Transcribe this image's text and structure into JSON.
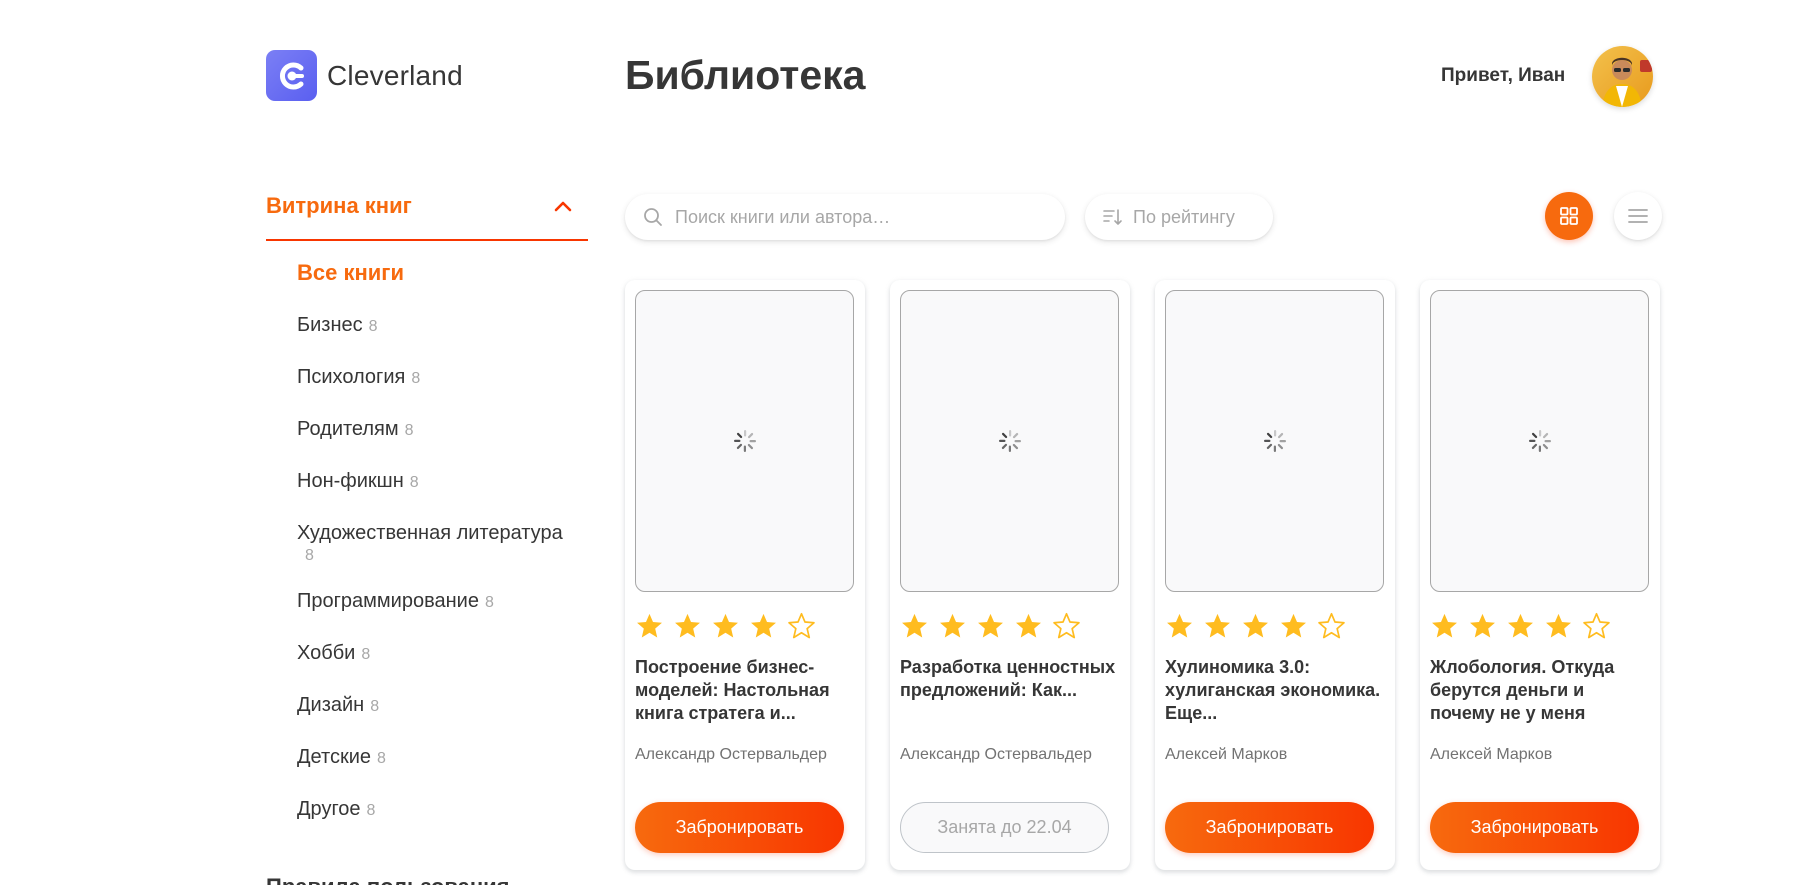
{
  "header": {
    "logo_text": "Cleverland",
    "page_title": "Библиотека",
    "greeting": "Привет, Иван"
  },
  "sidebar": {
    "section_title": "Витрина книг",
    "items": [
      {
        "label": "Все книги",
        "count": ""
      },
      {
        "label": "Бизнес",
        "count": "8"
      },
      {
        "label": "Психология",
        "count": "8"
      },
      {
        "label": "Родителям",
        "count": "8"
      },
      {
        "label": "Нон-фикшн",
        "count": "8"
      },
      {
        "label": "Художественная литература",
        "count": "8"
      },
      {
        "label": "Программирование",
        "count": "8"
      },
      {
        "label": "Хобби",
        "count": "8"
      },
      {
        "label": "Дизайн",
        "count": "8"
      },
      {
        "label": "Детские",
        "count": "8"
      },
      {
        "label": "Другое",
        "count": "8"
      }
    ],
    "rules_label": "Правила пользования"
  },
  "toolbar": {
    "search_placeholder": "Поиск книги или автора…",
    "search_value": "",
    "sort_label": "По рейтингу",
    "view_mode": "grid"
  },
  "books": [
    {
      "title": "Построение бизнес-моделей: Настольная книга стратега и...",
      "author": "Александр Остервальдер",
      "rating": 4,
      "button": "Забронировать",
      "status": "available"
    },
    {
      "title": "Разработка ценностных предложений: Как...",
      "author": "Александр Остервальдер",
      "rating": 4,
      "button": "Занята до 22.04",
      "status": "busy"
    },
    {
      "title": "Хулиномика 3.0: хулиганская экономика. Еще...",
      "author": "Алексей Марков",
      "rating": 4,
      "button": "Забронировать",
      "status": "available"
    },
    {
      "title": "Жлобология. Откуда берутся деньги и почему не у меня",
      "author": "Алексей Марков",
      "rating": 4,
      "button": "Забронировать",
      "status": "available"
    }
  ],
  "colors": {
    "accent": "#f76a0e",
    "accent_dark": "#f83600",
    "star": "#ffbc1f",
    "text": "#363636",
    "muted": "#a7a7a7"
  },
  "icons": [
    "logo-icon",
    "chevron-up-icon",
    "search-icon",
    "sort-icon",
    "grid-icon",
    "list-icon",
    "spinner-icon",
    "star-icon"
  ]
}
